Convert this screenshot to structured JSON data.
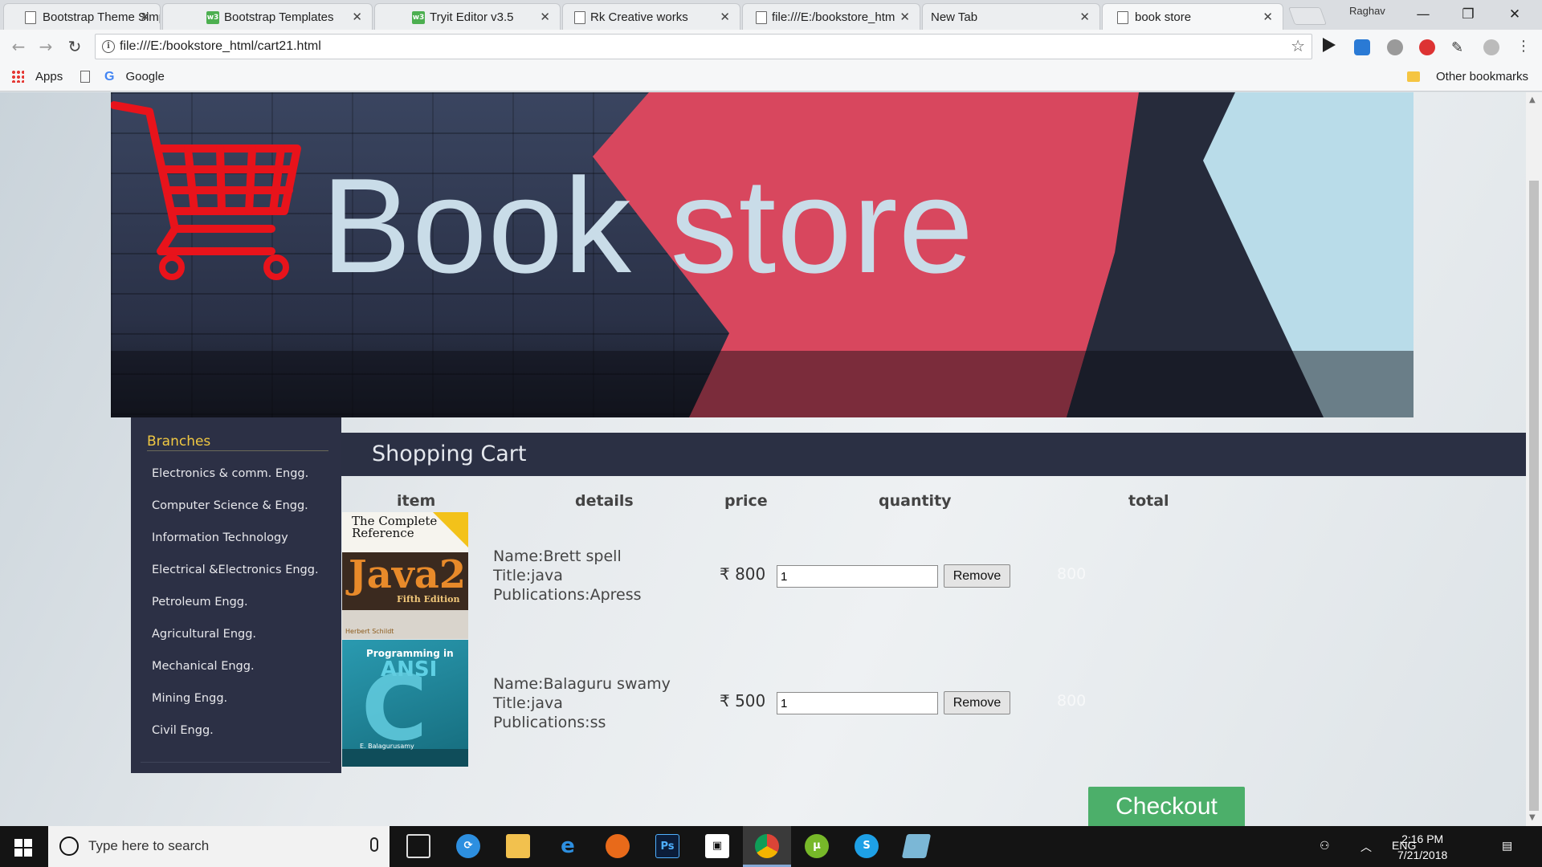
{
  "browser": {
    "tabs": [
      {
        "title": "Bootstrap Theme Simp",
        "icon": "document-icon"
      },
      {
        "title": "Bootstrap Templates",
        "icon": "w3schools-icon"
      },
      {
        "title": "Tryit Editor v3.5",
        "icon": "w3schools-icon"
      },
      {
        "title": "Rk Creative works",
        "icon": "document-icon"
      },
      {
        "title": "file:///E:/bookstore_htm",
        "icon": "document-icon"
      },
      {
        "title": "New Tab",
        "icon": "none"
      },
      {
        "title": "book store",
        "icon": "document-icon"
      }
    ],
    "active_tab": 6,
    "profile_name": "Raghav",
    "url": "file:///E:/bookstore_html/cart21.html",
    "bookmarks": {
      "apps": "Apps",
      "google": "Google",
      "other": "Other bookmarks"
    }
  },
  "page": {
    "banner_title": "Book store",
    "sidebar": {
      "heading": "Branches",
      "items": [
        "Electronics & comm. Engg.",
        "Computer Science & Engg.",
        "Information Technology",
        "Electrical &Electronics Engg.",
        "Petroleum Engg.",
        "Agricultural Engg.",
        "Mechanical Engg.",
        "Mining Engg.",
        "Civil Engg."
      ]
    },
    "cart": {
      "heading": "Shopping Cart",
      "columns": {
        "item": "item",
        "details": "details",
        "price": "price",
        "quantity": "quantity",
        "total": "total"
      },
      "rows": [
        {
          "cover": {
            "line1": "The",
            "line2": "Complete",
            "line3": "Reference",
            "title": "Java2",
            "edition": "Fifth Edition",
            "author": "Herbert Schildt"
          },
          "name": "Name:Brett spell",
          "title": "Title:java",
          "publication": "Publications:Apress",
          "price": "₹ 800",
          "quantity": "1",
          "remove_label": "Remove",
          "total": "800"
        },
        {
          "cover": {
            "line1": "Programming in",
            "title": "ANSI",
            "letter": "C",
            "author": "E. Balagurusamy"
          },
          "name": "Name:Balaguru swamy",
          "title": "Title:java",
          "publication": "Publications:ss",
          "price": "₹ 500",
          "quantity": "1",
          "remove_label": "Remove",
          "total": "800"
        }
      ],
      "checkout_label": "Checkout"
    }
  },
  "taskbar": {
    "search_placeholder": "Type here to search",
    "language": "ENG",
    "time": "2:16 PM",
    "date": "7/21/2018"
  },
  "colors": {
    "accent_yellow": "#f0c842",
    "sidebar_bg": "#2c3045",
    "checkout_green": "#4caf6a",
    "cart_red": "#e8131b"
  }
}
